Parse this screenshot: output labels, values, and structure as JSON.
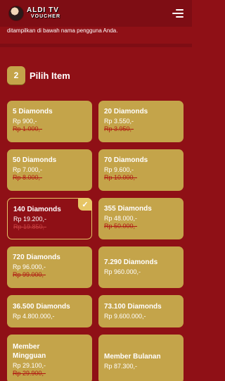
{
  "header": {
    "logo_line1": "ALDI TV",
    "logo_line2": "VOUCHER"
  },
  "helper_text": "ditampilkan di bawah nama pengguna Anda.",
  "step": {
    "number": "2",
    "title": "Pilih Item"
  },
  "items": [
    {
      "name": "5 Diamonds",
      "price": "Rp 900,-",
      "old_price": "Rp 1.000,-",
      "selected": false
    },
    {
      "name": "20 Diamonds",
      "price": "Rp 3.550,-",
      "old_price": "Rp 3.950,-",
      "selected": false
    },
    {
      "name": "50 Diamonds",
      "price": "Rp 7.000,-",
      "old_price": "Rp 8.000,-",
      "selected": false
    },
    {
      "name": "70 Diamonds",
      "price": "Rp 9.600,-",
      "old_price": "Rp 10.000,-",
      "selected": false
    },
    {
      "name": "140 Diamonds",
      "price": "Rp 19.200,-",
      "old_price": "Rp 19.850,-",
      "selected": true
    },
    {
      "name": "355 Diamonds",
      "price": "Rp 48.000,-",
      "old_price": "Rp 50.000,-",
      "selected": false
    },
    {
      "name": "720 Diamonds",
      "price": "Rp 96.000,-",
      "old_price": "Rp 99.000,-",
      "selected": false
    },
    {
      "name": "7.290 Diamonds",
      "price": "Rp 960.000,-",
      "old_price": "",
      "selected": false
    },
    {
      "name": "36.500 Diamonds",
      "price": "Rp 4.800.000,-",
      "old_price": "",
      "selected": false
    },
    {
      "name": "73.100 Diamonds",
      "price": "Rp 9.600.000,-",
      "old_price": "",
      "selected": false
    },
    {
      "name": "Member Mingguan",
      "price": "Rp 29.100,-",
      "old_price": "Rp 29.900,-",
      "selected": false
    },
    {
      "name": "Member Bulanan",
      "price": "Rp 87.300,-",
      "old_price": "",
      "selected": false
    }
  ],
  "check_glyph": "✓",
  "icons": {
    "menu": "menu-icon",
    "check": "check-icon"
  }
}
